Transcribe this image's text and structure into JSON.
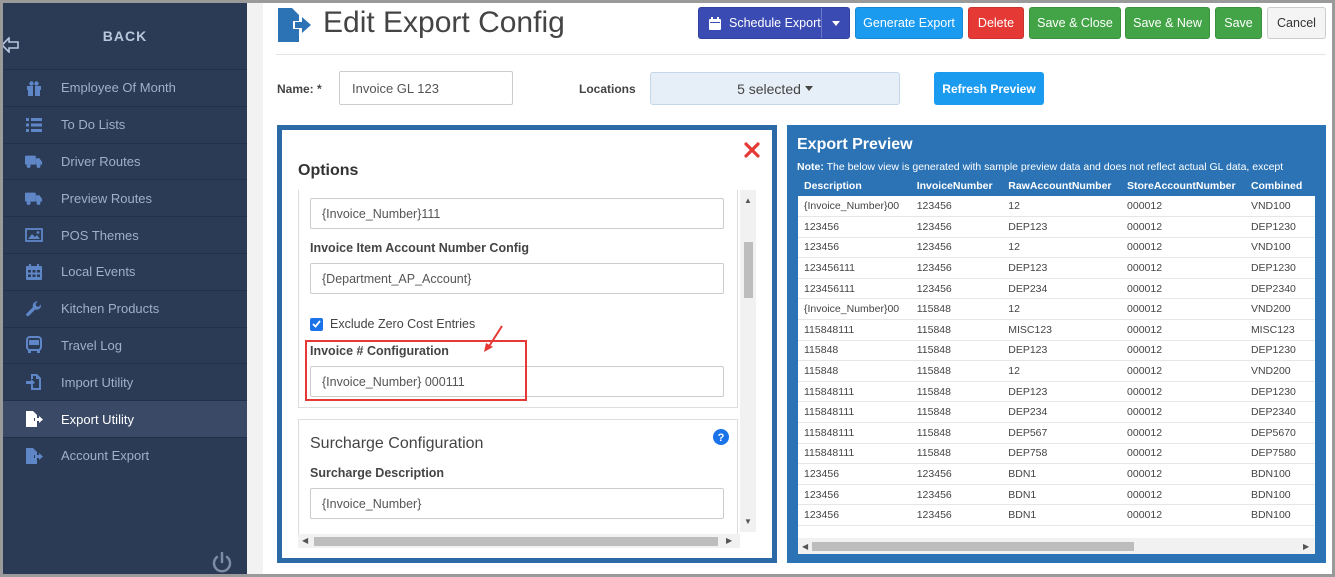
{
  "sidebar": {
    "back_label": "BACK",
    "items": [
      {
        "label": "Employee Of Month",
        "icon": "gift-icon"
      },
      {
        "label": "To Do Lists",
        "icon": "list-icon"
      },
      {
        "label": "Driver Routes",
        "icon": "truck-icon"
      },
      {
        "label": "Preview Routes",
        "icon": "truck-icon"
      },
      {
        "label": "POS Themes",
        "icon": "image-icon"
      },
      {
        "label": "Local Events",
        "icon": "calendar-icon"
      },
      {
        "label": "Kitchen Products",
        "icon": "wrench-icon"
      },
      {
        "label": "Travel Log",
        "icon": "bus-icon"
      },
      {
        "label": "Import Utility",
        "icon": "import-icon"
      },
      {
        "label": "Export Utility",
        "icon": "export-file-icon",
        "active": true
      },
      {
        "label": "Account Export",
        "icon": "export-file-icon"
      }
    ]
  },
  "header": {
    "title": "Edit Export Config",
    "buttons": {
      "schedule_export": "Schedule Export",
      "generate_export": "Generate Export",
      "delete": "Delete",
      "save_close": "Save & Close",
      "save_new": "Save & New",
      "save": "Save",
      "cancel": "Cancel"
    }
  },
  "form": {
    "name_label": "Name: *",
    "name_value": "Invoice GL 123",
    "locations_label": "Locations",
    "locations_value": "5 selected",
    "refresh_label": "Refresh Preview"
  },
  "options": {
    "title": "Options",
    "field_top_value": "{Invoice_Number}111",
    "item_account_label": "Invoice Item Account Number Config",
    "item_account_value": "{Department_AP_Account}",
    "exclude_zero_label": "Exclude Zero Cost Entries",
    "exclude_zero_checked": true,
    "invoice_config_label": "Invoice # Configuration",
    "invoice_config_value": "{Invoice_Number} 000111",
    "surcharge_title": "Surcharge Configuration",
    "surcharge_desc_label": "Surcharge Description",
    "surcharge_desc_value": "{Invoice_Number}"
  },
  "preview": {
    "title": "Export Preview",
    "note_bold": "Note:",
    "note_text": " The below view is generated with sample preview data and does not reflect actual GL data, except",
    "columns": [
      "Description",
      "InvoiceNumber",
      "RawAccountNumber",
      "StoreAccountNumber",
      "Combined"
    ],
    "rows": [
      [
        "{Invoice_Number}00",
        "123456",
        "12",
        "000012",
        "VND100"
      ],
      [
        "123456",
        "123456",
        "DEP123",
        "000012",
        "DEP1230"
      ],
      [
        "123456",
        "123456",
        "12",
        "000012",
        "VND100"
      ],
      [
        "123456111",
        "123456",
        "DEP123",
        "000012",
        "DEP1230"
      ],
      [
        "123456111",
        "123456",
        "DEP234",
        "000012",
        "DEP2340"
      ],
      [
        "{Invoice_Number}00",
        "115848",
        "12",
        "000012",
        "VND200"
      ],
      [
        "115848111",
        "115848",
        "MISC123",
        "000012",
        "MISC123"
      ],
      [
        "115848",
        "115848",
        "DEP123",
        "000012",
        "DEP1230"
      ],
      [
        "115848",
        "115848",
        "12",
        "000012",
        "VND200"
      ],
      [
        "115848111",
        "115848",
        "DEP123",
        "000012",
        "DEP1230"
      ],
      [
        "115848111",
        "115848",
        "DEP234",
        "000012",
        "DEP2340"
      ],
      [
        "115848111",
        "115848",
        "DEP567",
        "000012",
        "DEP5670"
      ],
      [
        "115848111",
        "115848",
        "DEP758",
        "000012",
        "DEP7580"
      ],
      [
        "123456",
        "123456",
        "BDN1",
        "000012",
        "BDN100"
      ],
      [
        "123456",
        "123456",
        "BDN1",
        "000012",
        "BDN100"
      ],
      [
        "123456",
        "123456",
        "BDN1",
        "000012",
        "BDN100"
      ]
    ]
  },
  "colors": {
    "sidebar_bg": "#2b3a55",
    "accent_blue": "#1a9bf0",
    "panel_blue": "#2b6aa6",
    "delete_red": "#e53935",
    "save_green": "#43a447",
    "schedule_indigo": "#3a4bb3"
  }
}
